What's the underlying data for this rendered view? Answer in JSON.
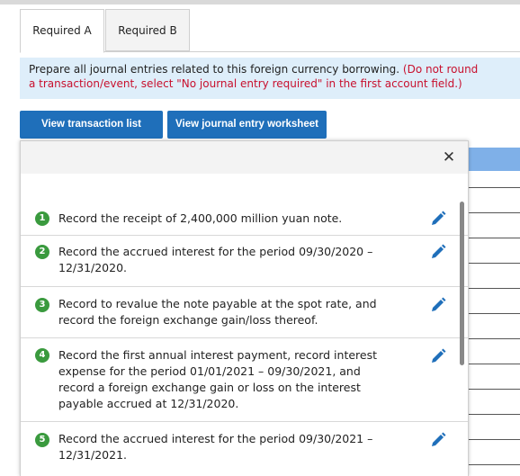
{
  "tabs": [
    {
      "label": "Required A",
      "active": true
    },
    {
      "label": "Required B",
      "active": false
    }
  ],
  "instructions": {
    "main": "Prepare all journal entries related to this foreign currency borrowing.",
    "note_line1": "(Do not round",
    "note_line2": "a transaction/event, select \"No journal entry required\" in the first account field.)"
  },
  "buttons": {
    "view_list": "View transaction list",
    "view_worksheet": "View journal entry worksheet"
  },
  "panel": {
    "close_icon": "close-icon",
    "items": [
      {
        "number": "1",
        "text_lines": [
          "Record the receipt of 2,400,000 million yuan note."
        ]
      },
      {
        "number": "2",
        "text_lines": [
          "Record the accrued interest for the period 09/30/2020 –",
          "12/31/2020."
        ]
      },
      {
        "number": "3",
        "text_lines": [
          "Record to revalue the note payable at the spot rate, and",
          "record the foreign exchange gain/loss thereof."
        ]
      },
      {
        "number": "4",
        "text_lines": [
          "Record the first annual interest payment, record interest",
          "expense for the period 01/01/2021 – 09/30/2021, and",
          "record a foreign exchange gain or loss on the interest",
          "payable accrued at 12/31/2020."
        ]
      },
      {
        "number": "5",
        "text_lines": [
          "Record the accrued interest for the period 09/30/2021 –",
          "12/31/2021."
        ]
      }
    ]
  },
  "colors": {
    "accent_button": "#1f6fba",
    "number_badge": "#3a9a3e",
    "note_text": "#c8102e",
    "edit_icon": "#1f6fba"
  }
}
